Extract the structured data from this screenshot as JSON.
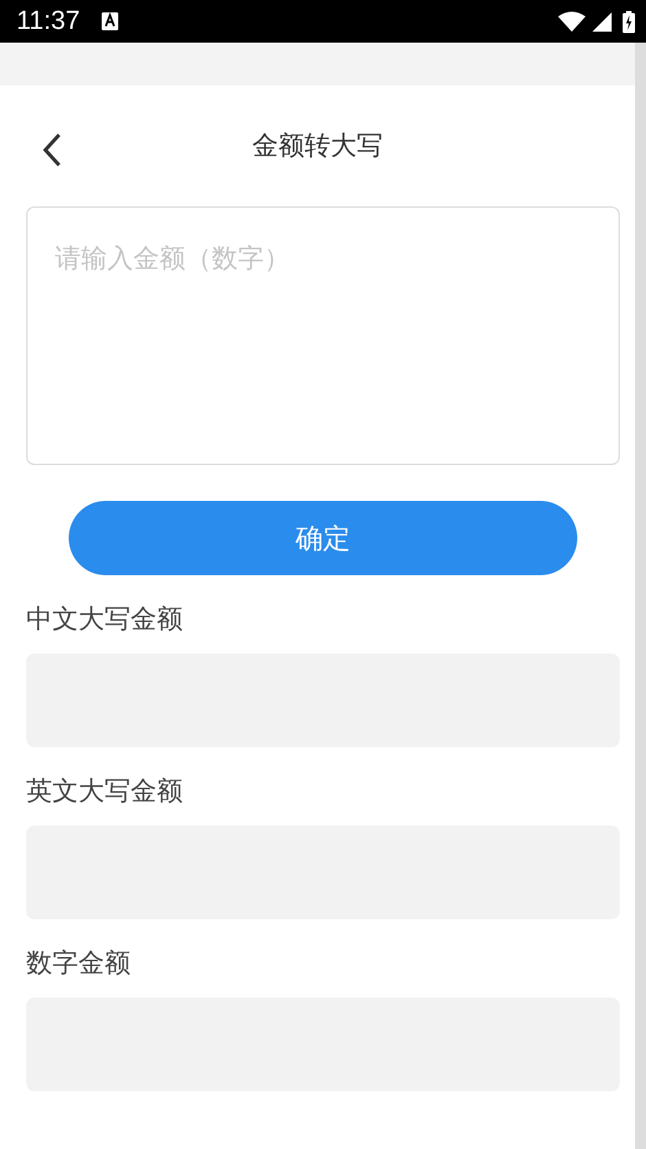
{
  "status_bar": {
    "time": "11:37"
  },
  "header": {
    "title": "金额转大写"
  },
  "input": {
    "placeholder": "请输入金额（数字）"
  },
  "confirm_button": {
    "label": "确定"
  },
  "results": [
    {
      "label": "中文大写金额"
    },
    {
      "label": "英文大写金额"
    },
    {
      "label": "数字金额"
    }
  ]
}
